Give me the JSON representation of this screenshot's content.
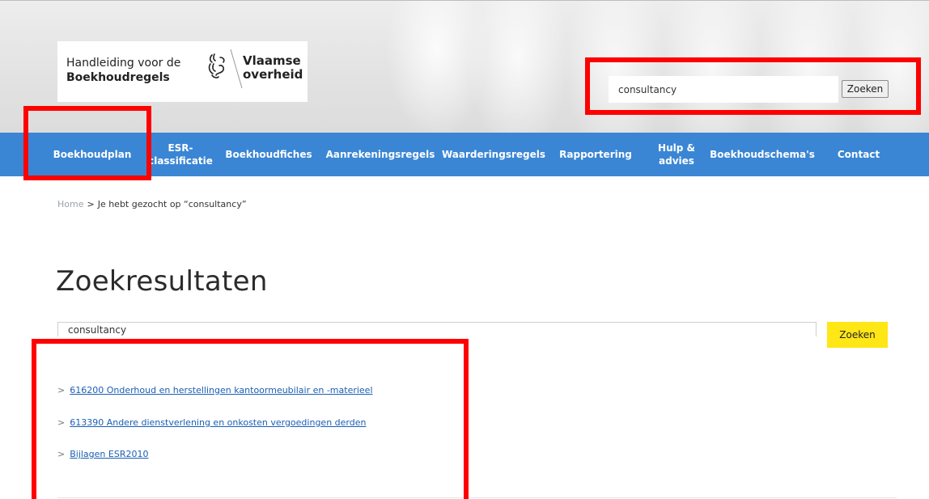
{
  "header": {
    "logo_title_line1": "Handleiding voor de",
    "logo_title_line2": "Boekhoudregels",
    "logo_gov_line1": "Vlaamse",
    "logo_gov_line2": "overheid",
    "search_value": "consultancy",
    "search_button": "Zoeken"
  },
  "nav": {
    "items": [
      {
        "label": "Boekhoudplan"
      },
      {
        "label": "ESR-\nclassificatie"
      },
      {
        "label": "Boekhoudfiches"
      },
      {
        "label": "Aanrekeningsregels"
      },
      {
        "label": "Waarderingsregels"
      },
      {
        "label": "Rapportering"
      },
      {
        "label": "Hulp &\nadvies"
      },
      {
        "label": "Boekhoudschema's"
      },
      {
        "label": "Contact"
      }
    ]
  },
  "breadcrumb": {
    "home": "Home",
    "separator": ">",
    "current": "Je hebt gezocht op “consultancy”"
  },
  "main": {
    "title": "Zoekresultaten",
    "search_value": "consultancy",
    "search_button": "Zoeken",
    "results": [
      {
        "chevron": ">",
        "label": "616200 Onderhoud en herstellingen kantoormeubilair en -materieel"
      },
      {
        "chevron": ">",
        "label": "613390 Andere dienstverlening en onkosten vergoedingen derden"
      },
      {
        "chevron": ">",
        "label": "Bijlagen ESR2010"
      }
    ]
  },
  "colors": {
    "nav_bg": "#3a86d4",
    "search_button_bg": "#ffe615",
    "link": "#1a5fb4",
    "annotation": "#ff0000"
  }
}
